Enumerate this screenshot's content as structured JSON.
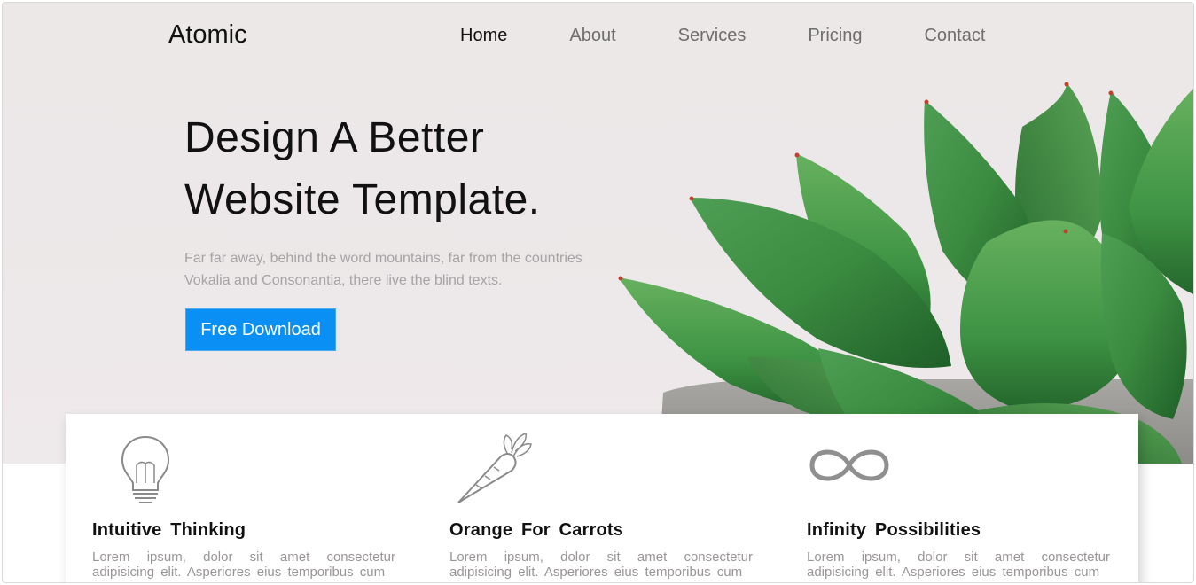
{
  "brand": {
    "logo": "Atomic"
  },
  "nav": {
    "items": [
      {
        "label": "Home",
        "active": true
      },
      {
        "label": "About",
        "active": false
      },
      {
        "label": "Services",
        "active": false
      },
      {
        "label": "Pricing",
        "active": false
      },
      {
        "label": "Contact",
        "active": false
      }
    ]
  },
  "hero": {
    "headline_line1": "Design A Better",
    "headline_line2": "Website Template.",
    "subtext": "Far far away, behind the word mountains, far from the countries Vokalia and Consonantia, there live the blind texts.",
    "cta_label": "Free Download",
    "image": "succulent-plant"
  },
  "features": [
    {
      "icon": "lightbulb-icon",
      "title": "Intuitive  Thinking",
      "text": "Lorem ipsum, dolor sit amet consectetur adipisicing elit. Asperiores eius temporibus cum"
    },
    {
      "icon": "carrot-icon",
      "title": "Orange  For  Carrots",
      "text": "Lorem ipsum, dolor sit amet consectetur adipisicing elit. Asperiores eius temporibus cum"
    },
    {
      "icon": "infinity-icon",
      "title": "Infinity  Possibilities",
      "text": "Lorem ipsum, dolor sit amet consectetur adipisicing elit. Asperiores eius temporibus cum"
    }
  ],
  "colors": {
    "accent": "#0a8ff5",
    "text_dark": "#111111",
    "text_muted": "#a7a3a4",
    "plant_green": "#3e9a45"
  }
}
